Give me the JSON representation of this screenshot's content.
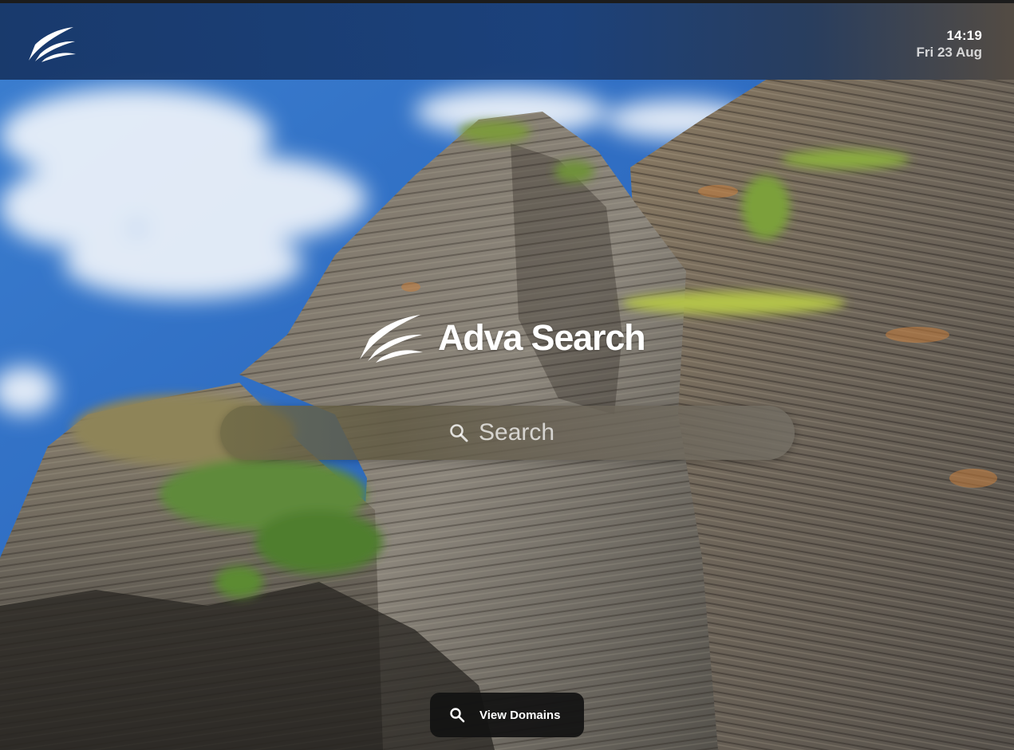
{
  "app": {
    "name": "Adva Search"
  },
  "topbar": {
    "logo_icon": "adva-wing-logo-icon",
    "time": "14:19",
    "date": "Fri 23 Aug"
  },
  "brand": {
    "logo_icon": "adva-wing-logo-icon",
    "name": "Adva Search"
  },
  "search": {
    "icon": "search-icon",
    "placeholder": "Search",
    "value": ""
  },
  "domains_button": {
    "icon": "search-icon",
    "label": "View Domains"
  },
  "colors": {
    "topbar": "#163464",
    "sky": "#2d6fc4",
    "text": "#ffffff",
    "button_bg": "#121212"
  }
}
